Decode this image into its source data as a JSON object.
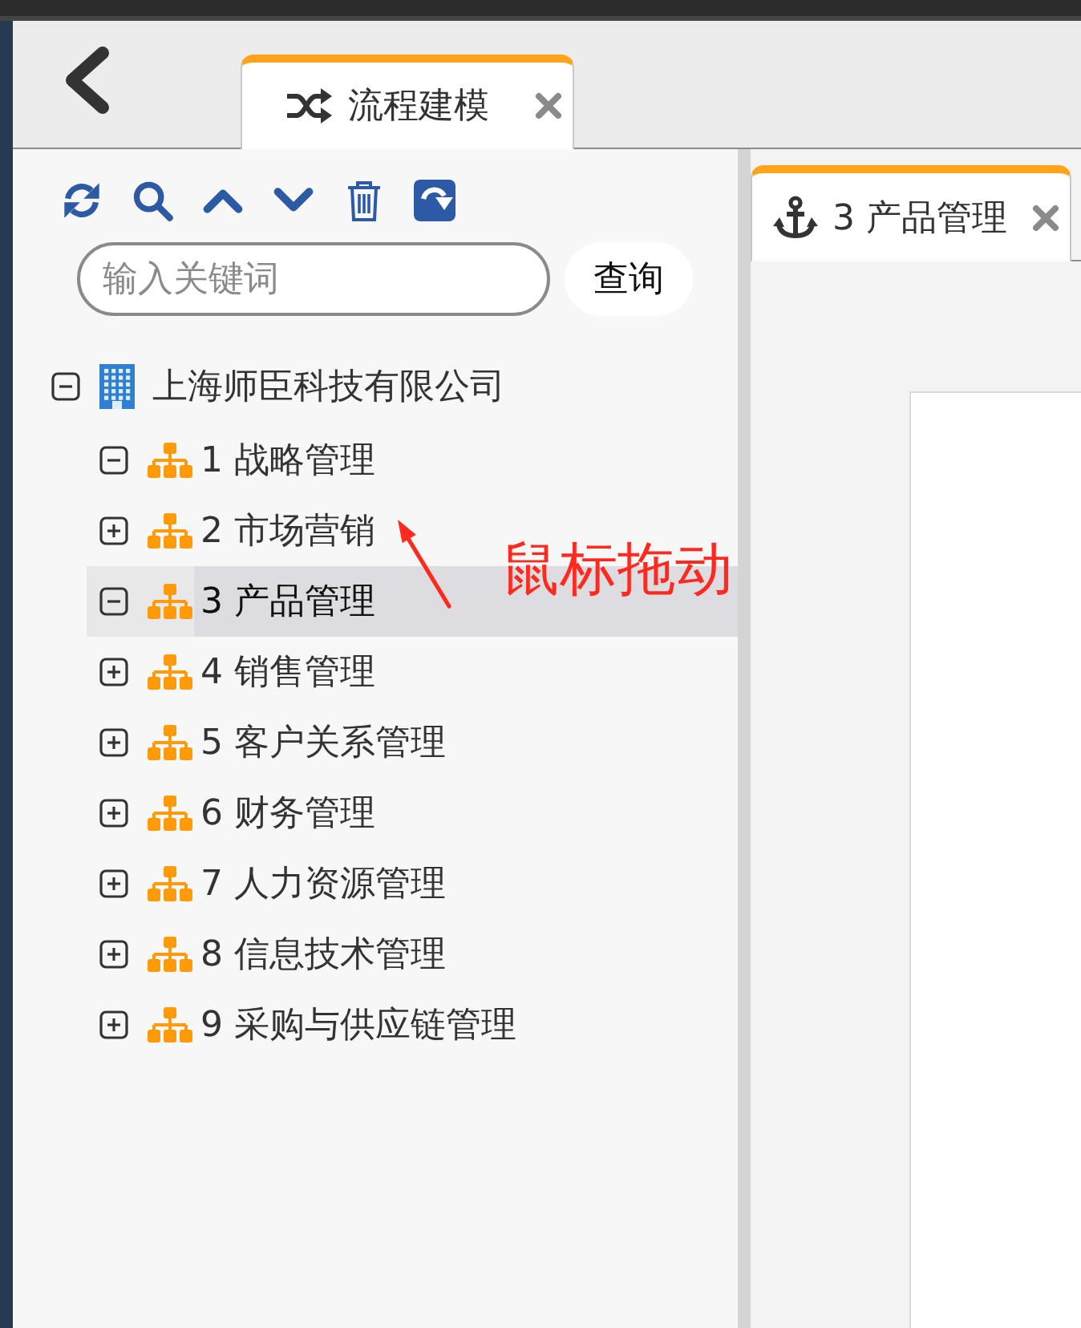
{
  "header": {
    "tabs": [
      {
        "label": "流程建模",
        "selected": true
      }
    ]
  },
  "search": {
    "placeholder": "输入关键词",
    "button": "查询"
  },
  "tree": {
    "label": "上海师臣科技有限公司",
    "kind": "company",
    "expanded": true,
    "selected": false,
    "children": [
      {
        "label": "1 战略管理",
        "kind": "department",
        "expanded": true,
        "selected": false
      },
      {
        "label": "2 市场营销",
        "kind": "department",
        "expanded": false,
        "selected": false
      },
      {
        "label": "3 产品管理",
        "kind": "department",
        "expanded": true,
        "selected": true
      },
      {
        "label": "4 销售管理",
        "kind": "department",
        "expanded": false,
        "selected": false
      },
      {
        "label": "5 客户关系管理",
        "kind": "department",
        "expanded": false,
        "selected": false
      },
      {
        "label": "6 财务管理",
        "kind": "department",
        "expanded": false,
        "selected": false
      },
      {
        "label": "7 人力资源管理",
        "kind": "department",
        "expanded": false,
        "selected": false
      },
      {
        "label": "8 信息技术管理",
        "kind": "department",
        "expanded": false,
        "selected": false
      },
      {
        "label": "9 采购与供应链管理",
        "kind": "department",
        "expanded": false,
        "selected": false
      }
    ]
  },
  "annotation": {
    "text": "鼠标拖动"
  },
  "editor": {
    "tabs": [
      {
        "label": "3 产品管理",
        "selected": true
      }
    ]
  }
}
